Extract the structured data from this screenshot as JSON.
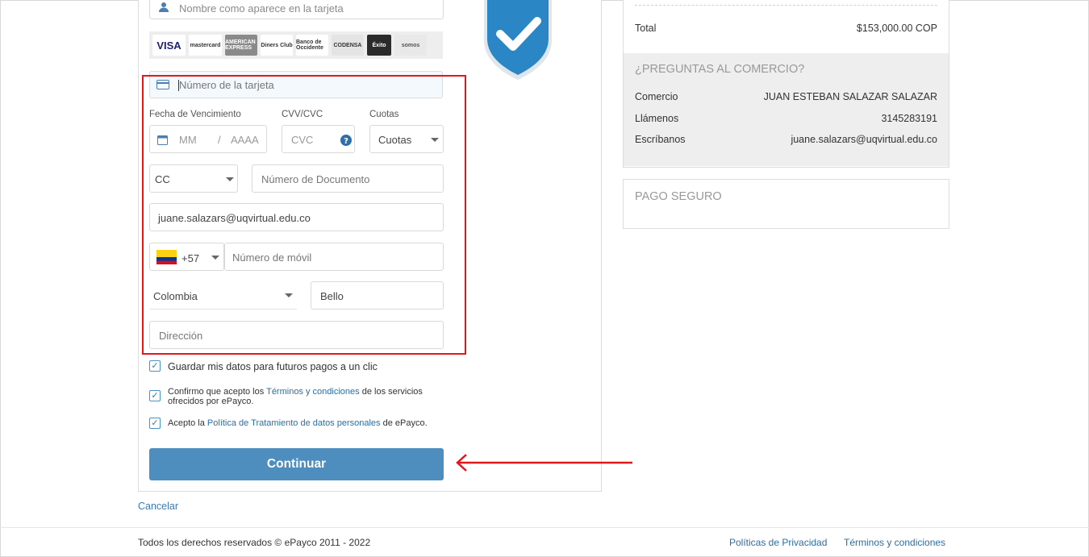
{
  "form": {
    "name_placeholder": "Nombre como aparece en la tarjeta",
    "card_brands": [
      {
        "label": "VISA",
        "bg": "#ffffff",
        "color": "#1a1f71"
      },
      {
        "label": "mastercard",
        "bg": "#ffffff",
        "color": "#333"
      },
      {
        "label": "AMERICAN EXPRESS",
        "bg": "#8a8a8a",
        "color": "#ffffff"
      },
      {
        "label": "Diners Club",
        "bg": "#ffffff",
        "color": "#333"
      },
      {
        "label": "Banco de Occidente",
        "bg": "#ffffff",
        "color": "#333"
      },
      {
        "label": "CODENSA",
        "bg": "#e4e4e4",
        "color": "#333"
      },
      {
        "label": "Éxito",
        "bg": "#2b2b2b",
        "color": "#ffffff"
      },
      {
        "label": "somos",
        "bg": "#e9e9e9",
        "color": "#555"
      }
    ],
    "card_number_placeholder": "Número de la tarjeta",
    "expiry_label": "Fecha de Vencimiento",
    "expiry_month_placeholder": "MM",
    "expiry_separator": "/",
    "expiry_year_placeholder": "AAAA",
    "cvv_label": "CVV/CVC",
    "cvv_placeholder": "CVC",
    "installments_label": "Cuotas",
    "installments_value": "Cuotas",
    "doc_type_value": "CC",
    "doc_number_placeholder": "Número de Documento",
    "email_value": "juane.salazars@uqvirtual.edu.co",
    "phone_prefix": "+57",
    "phone_placeholder": "Número de móvil",
    "country_value": "Colombia",
    "city_value": "Bello",
    "address_placeholder": "Dirección"
  },
  "checks": {
    "save_data": "Guardar mis datos para futuros pagos a un clic",
    "terms_prefix": "Confirmo que acepto los ",
    "terms_link": "Términos y condiciones",
    "terms_suffix_1": " de los servicios",
    "terms_suffix_2": "ofrecidos por ePayco.",
    "privacy_prefix": "Acepto la ",
    "privacy_link": "Política de Tratamiento de datos personales",
    "privacy_suffix": " de ePayco."
  },
  "actions": {
    "continue_label": "Continuar",
    "cancel_label": "Cancelar"
  },
  "summary": {
    "total_label": "Total",
    "total_value": "$153,000.00 COP",
    "qa_title": "¿PREGUNTAS AL COMERCIO?",
    "merchant_label": "Comercio",
    "merchant_value": "JUAN ESTEBAN SALAZAR SALAZAR",
    "call_label": "Llámenos",
    "call_value": "3145283191",
    "write_label": "Escríbanos",
    "write_value": "juane.salazars@uqvirtual.edu.co",
    "secure_title": "PAGO SEGURO"
  },
  "footer": {
    "copyright": "Todos los derechos reservados © ePayco 2011 - 2022",
    "privacy_link": "Políticas de Privacidad",
    "terms_link": "Términos y condiciones"
  },
  "colors": {
    "accent": "#4d8ebf",
    "highlight": "#e0181b",
    "shield": "#2b86c5"
  }
}
